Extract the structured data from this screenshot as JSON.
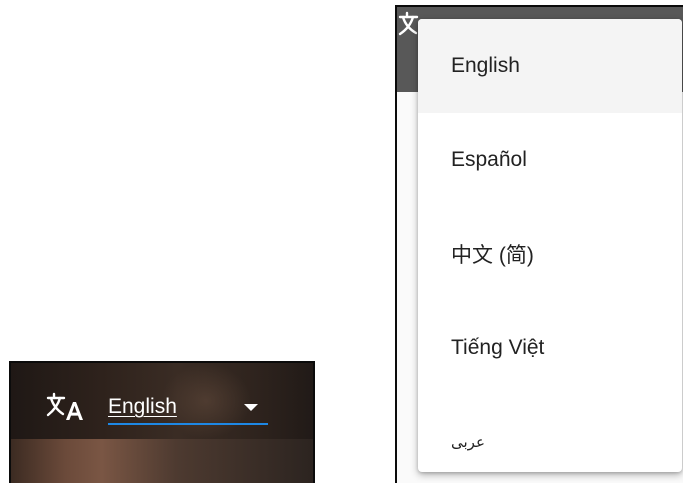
{
  "selector": {
    "selected_language": "English"
  },
  "dropdown": {
    "options": [
      {
        "label": "English",
        "selected": true
      },
      {
        "label": "Español",
        "selected": false
      },
      {
        "label": "中文 (简)",
        "selected": false
      },
      {
        "label": "Tiếng Việt",
        "selected": false
      },
      {
        "label": "عربى",
        "selected": false
      }
    ]
  },
  "icons": {
    "translate": "translate-icon",
    "caret": "caret-down-icon"
  },
  "colors": {
    "selector_underline": "#1e88e5",
    "selector_text": "#ffffff",
    "menu_text": "#222222",
    "selected_item_bg": "#f4f4f4"
  }
}
